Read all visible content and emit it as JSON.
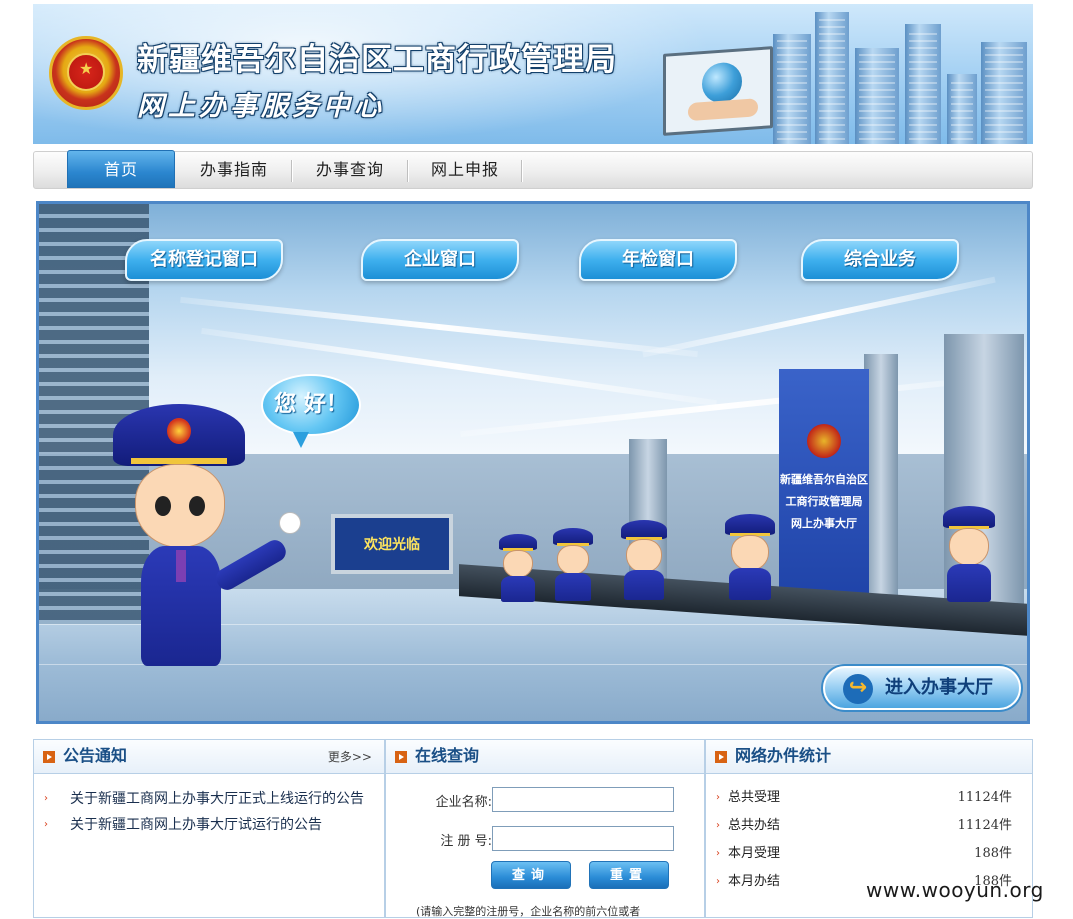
{
  "header": {
    "title_line1": "新疆维吾尔自治区工商行政管理局",
    "title_line2": "网上办事服务中心"
  },
  "nav": {
    "items": [
      {
        "label": "首页",
        "active": true
      },
      {
        "label": "办事指南",
        "active": false
      },
      {
        "label": "办事查询",
        "active": false
      },
      {
        "label": "网上申报",
        "active": false
      }
    ]
  },
  "hall": {
    "windows": [
      "名称登记窗口",
      "企业窗口",
      "年检窗口",
      "综合业务"
    ],
    "greeting": "您 好！",
    "welcome_sign": "欢迎光临",
    "hall_sign_lines": [
      "新疆维吾尔自治区",
      "工商行政管理局",
      "网上办事大厅"
    ],
    "enter_button": "进入办事大厅"
  },
  "notice": {
    "title": "公告通知",
    "more": "更多>>",
    "items": [
      "关于新疆工商网上办事大厅正式上线运行的公告",
      "关于新疆工商网上办事大厅试运行的公告"
    ]
  },
  "query": {
    "title": "在线查询",
    "company_label": "企业名称:",
    "regno_label": "注 册 号:",
    "company_value": "",
    "regno_value": "",
    "search_button": "查询",
    "reset_button": "重置",
    "hint": "(请输入完整的注册号，企业名称的前六位或者"
  },
  "stats": {
    "title": "网络办件统计",
    "rows": [
      {
        "label": "总共受理",
        "value": "11124件"
      },
      {
        "label": "总共办结",
        "value": "11124件"
      },
      {
        "label": "本月受理",
        "value": "188件"
      },
      {
        "label": "本月办结",
        "value": "188件"
      }
    ]
  },
  "watermark": "www.wooyun.org",
  "colors": {
    "nav_active": "#2b86cf",
    "panel_border": "#b7cfe6",
    "panel_title": "#1a4f86",
    "accent_orange": "#d86313"
  }
}
